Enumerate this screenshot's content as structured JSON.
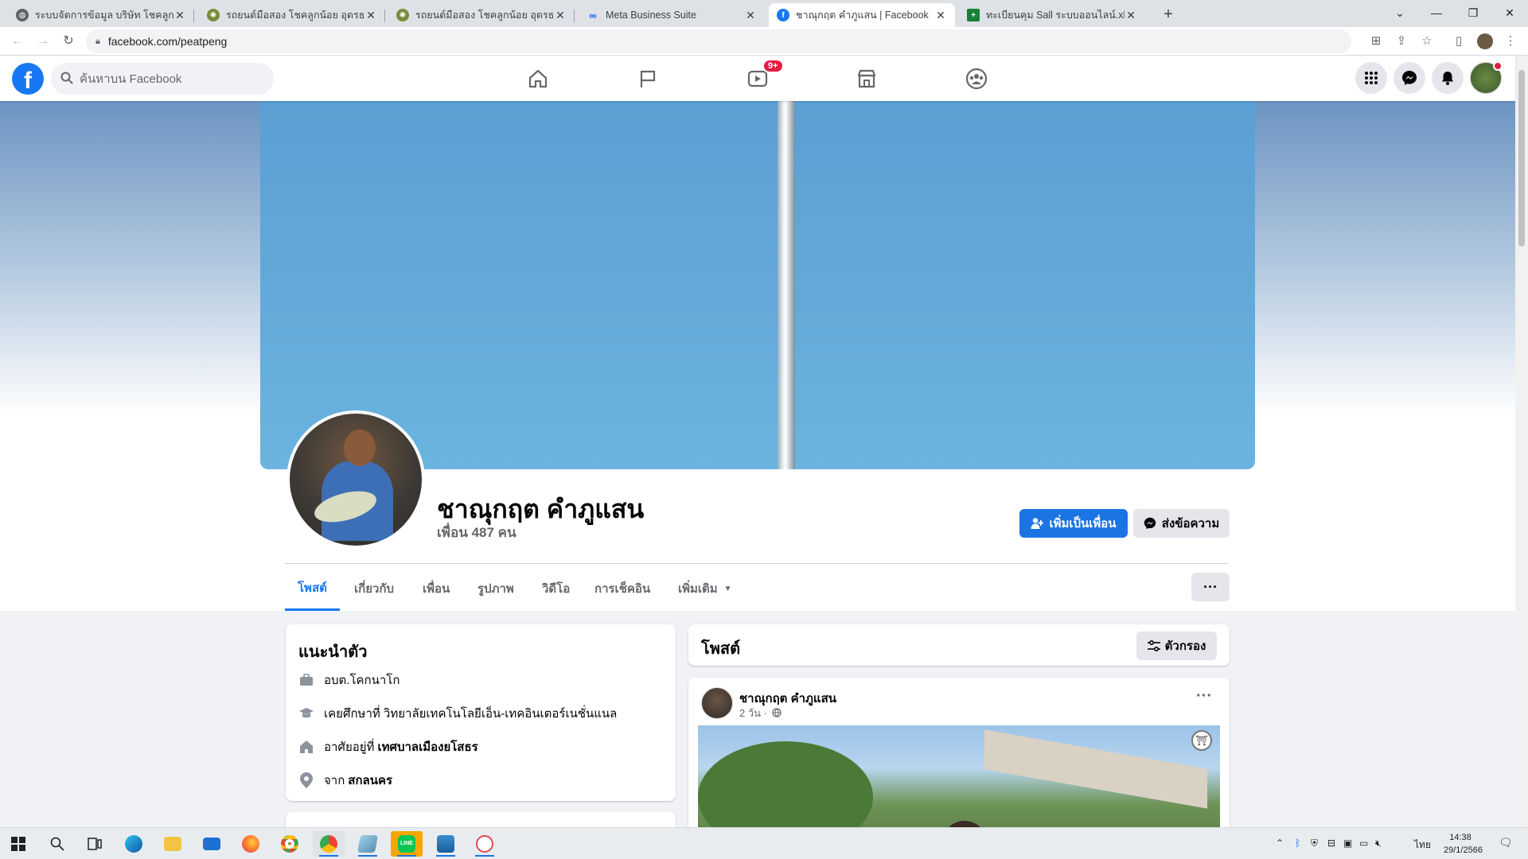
{
  "browser": {
    "tabs": [
      {
        "title": "ระบบจัดการข้อมูล บริษัท โชคลูกน้อย อ",
        "active": false
      },
      {
        "title": "รถยนต์มือสอง โชคลูกน้อย อุดรธานี",
        "active": false
      },
      {
        "title": "รถยนต์มือสอง โชคลูกน้อย อุดรธานี",
        "active": false
      },
      {
        "title": "Meta Business Suite",
        "active": false
      },
      {
        "title": "ชาณุกฤต คำภูแสน | Facebook",
        "active": true
      },
      {
        "title": "ทะเบียนคุม Sall ระบบออนไลน์.xlsx - G",
        "active": false
      }
    ],
    "url": "facebook.com/peatpeng"
  },
  "fb_nav": {
    "logo": "f",
    "search_placeholder": "ค้นหาบน Facebook",
    "watch_badge": "9+"
  },
  "profile": {
    "name": "ชาณุกฤต คำภูแสน",
    "friends": "เพื่อน 487 คน",
    "add_friend_label": "เพิ่มเป็นเพื่อน",
    "message_label": "ส่งข้อความ",
    "more_label": "···",
    "tabs": [
      "โพสต์",
      "เกี่ยวกับ",
      "เพื่อน",
      "รูปภาพ",
      "วิดีโอ",
      "การเช็คอิน",
      "เพิ่มเติม"
    ]
  },
  "intro": {
    "title": "แนะนำตัว",
    "work": "อบต.โคกนาโก",
    "education": "เคยศึกษาที่ วิทยาลัยเทคโนโลยีเอ็น-เทคอินเตอร์เนชั่นแนล",
    "lives_prefix": "อาศัยอยู่ที่",
    "lives_place": "เทศบาลเมืองยโสธร",
    "from_prefix": "จาก",
    "from_place": "สกลนคร"
  },
  "posts": {
    "title": "โพสต์",
    "filter_label": "ตัวกรอง",
    "post": {
      "author": "ชาณุกฤต คำภูแสน",
      "time": "2 วัน ·",
      "privacy_icon": "globe-icon"
    }
  },
  "taskbar": {
    "time": "14:38",
    "date": "29/1/2566",
    "lang": "ไทย"
  },
  "colors": {
    "fb_blue": "#1877f2",
    "button_blue": "#1b74e4",
    "badge_red": "#e41e3f"
  }
}
